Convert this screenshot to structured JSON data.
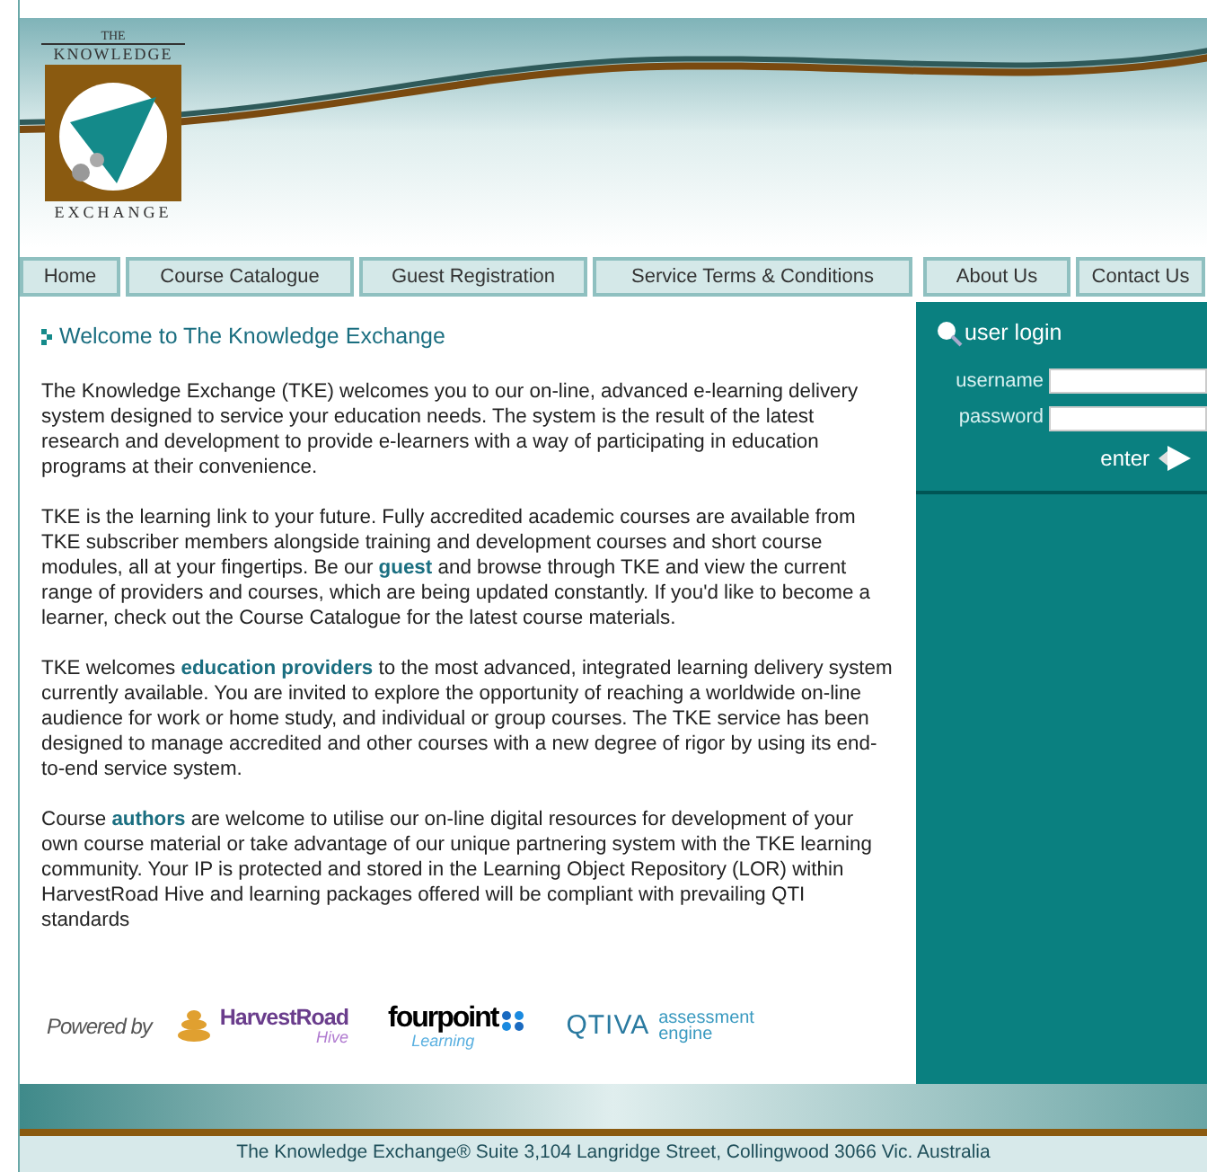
{
  "logo": {
    "top": "THE",
    "middle": "KNOWLEDGE",
    "bottom": "EXCHANGE"
  },
  "nav": [
    {
      "label": "Home",
      "selected": false
    },
    {
      "label": "Course Catalogue",
      "selected": false
    },
    {
      "label": "Guest Registration",
      "selected": false
    },
    {
      "label": "Service Terms & Conditions",
      "selected": false
    },
    {
      "label": "About Us",
      "selected": false
    },
    {
      "label": "Contact Us",
      "selected": false
    }
  ],
  "welcome": {
    "heading": "Welcome to The Knowledge Exchange",
    "paragraphs": [
      "The Knowledge Exchange (TKE) welcomes you to our on-line, advanced e-learning delivery system designed to service your education needs. The system is the result of the latest research and development to provide e-learners with a way of participating in education programs at their convenience.",
      "TKE is the learning link to your future. Fully accredited academic courses are available from TKE subscriber members alongside training and development courses and short course modules, all at your fingertips. Be our **guest** and browse through TKE and view the current range of providers and courses, which are being updated constantly. If you'd like to become a learner, check out the Course Catalogue for the latest course materials.",
      "TKE welcomes **education providers** to the most advanced, integrated learning delivery system currently available. You are invited to explore the opportunity of reaching a worldwide on-line audience for work or home study, and individual or group courses. The TKE service has been designed to manage accredited and other courses with a new degree of rigor by using its end-to-end service system.",
      "Course **authors** are welcome to utilise our on-line digital resources for development of your own course material or take advantage of our unique partnering system with the TKE learning community. Your IP is protected and stored in the Learning Object Repository (LOR) within HarvestRoad Hive and learning packages offered will be compliant with prevailing QTI standards"
    ]
  },
  "powered_by": {
    "label": "Powered by",
    "logos": [
      {
        "kind": "harvestroad",
        "name": "HarvestRoad",
        "sub": "Hive"
      },
      {
        "kind": "fourpoint",
        "name": "fourpoint",
        "sub": "Learning"
      },
      {
        "kind": "qtiva",
        "name": "QTIVA",
        "sub": "assessment engine"
      }
    ]
  },
  "login": {
    "title": "user login",
    "fields": [
      {
        "label": "username"
      },
      {
        "label": "password"
      }
    ],
    "button": "enter"
  },
  "footer": "The Knowledge Exchange® Suite 3,104 Langridge Street, Collingwood 3066 Vic. Australia"
}
